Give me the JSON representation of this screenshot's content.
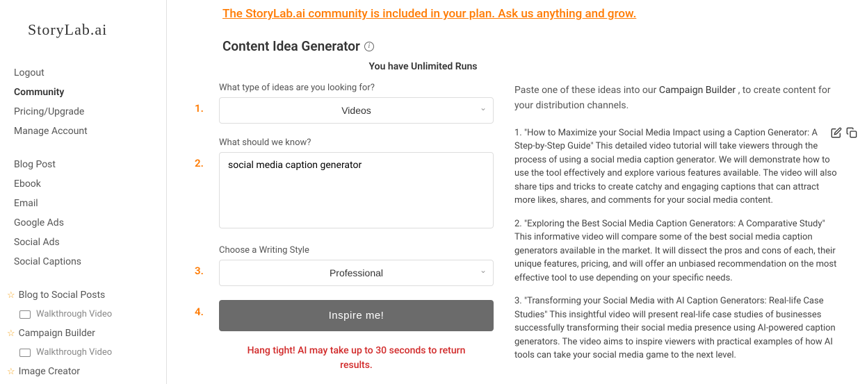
{
  "logo": "StoryLab.ai",
  "community_banner": "The StoryLab.ai community is included in your plan. Ask us anything and grow.",
  "sidebar": {
    "nav1": [
      {
        "label": "Logout",
        "bold": false
      },
      {
        "label": "Community",
        "bold": true
      },
      {
        "label": "Pricing/Upgrade",
        "bold": false
      },
      {
        "label": "Manage Account",
        "bold": false
      }
    ],
    "nav2": [
      {
        "label": "Blog Post"
      },
      {
        "label": "Ebook"
      },
      {
        "label": "Email"
      },
      {
        "label": "Google Ads"
      },
      {
        "label": "Social Ads"
      },
      {
        "label": "Social Captions"
      }
    ],
    "nav3": [
      {
        "label": "Blog to Social Posts",
        "sub": "Walkthrough Video"
      },
      {
        "label": "Campaign Builder",
        "sub": "Walkthrough Video"
      },
      {
        "label": "Image Creator",
        "sub": null
      }
    ]
  },
  "page_title": "Content Idea Generator",
  "runs_text": "You have Unlimited Runs",
  "form": {
    "step1_label": "What type of ideas are you looking for?",
    "step1_value": "Videos",
    "step2_label": "What should we know?",
    "step2_value": "social media caption generator",
    "step3_label": "Choose a Writing Style",
    "step3_value": "Professional",
    "button": "Inspire me!"
  },
  "wait_message": "Hang tight! AI may take up to 30 seconds to return results.",
  "results": {
    "intro_part1": "Paste one of these ideas into our ",
    "intro_link": "Campaign Builder",
    "intro_part2": " , to create content for your distribution channels.",
    "items": [
      "1. \"How to Maximize your Social Media Impact using a Caption Generator: A Step-by-Step Guide\"\nThis detailed video tutorial will take viewers through the process of using a social media caption generator. We will demonstrate how to use the tool effectively and explore various features available. The video will also share tips and tricks to create catchy and engaging captions that can attract more likes, shares, and comments for your social media content.",
      "2. \"Exploring the Best Social Media Caption Generators: A Comparative Study\"\nThis informative video will compare some of the best social media caption generators available in the market. It will dissect the pros and cons of each, their unique features, pricing, and will offer an unbiased recommendation on the most effective tool to use depending on your specific needs.",
      "3. \"Transforming your Social Media with AI Caption Generators: Real-life Case Studies\"\nThis insightful video will present real-life case studies of businesses successfully transforming their social media presence using AI-powered caption generators. The video aims to inspire viewers with practical examples of how AI tools can take your social media game to the next level."
    ]
  }
}
